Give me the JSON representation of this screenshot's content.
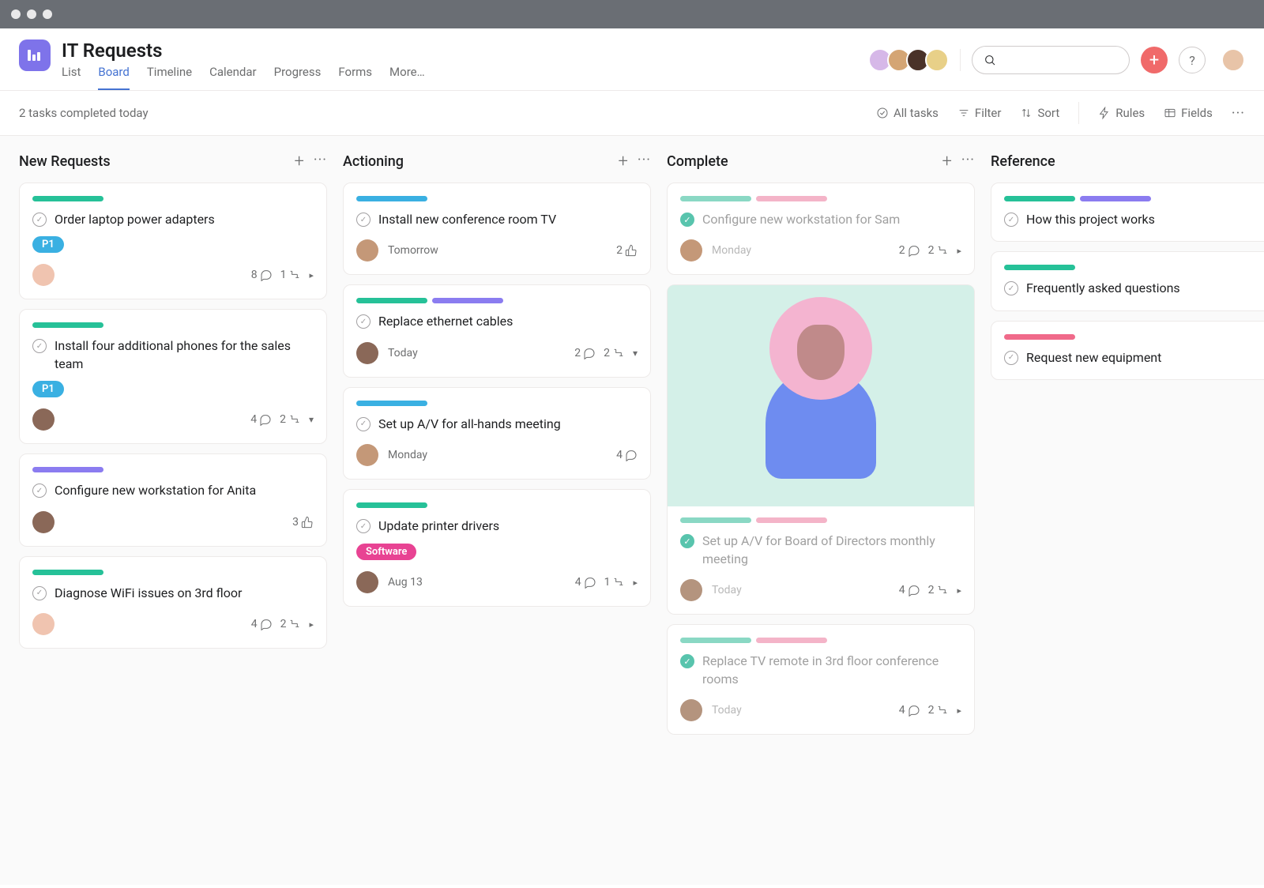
{
  "project": {
    "title": "IT Requests"
  },
  "tabs": [
    "List",
    "Board",
    "Timeline",
    "Calendar",
    "Progress",
    "Forms",
    "More…"
  ],
  "active_tab": "Board",
  "status_text": "2 tasks completed today",
  "toolbar": {
    "all_tasks": "All tasks",
    "filter": "Filter",
    "sort": "Sort",
    "rules": "Rules",
    "fields": "Fields"
  },
  "avatars_header": [
    "#d6b8e8",
    "#d4a574",
    "#4a3228",
    "#e8d088"
  ],
  "user_avatar": "#e8c4a8",
  "columns": [
    {
      "title": "New Requests",
      "cards": [
        {
          "colors": [
            "#26c198"
          ],
          "title": "Order laptop power adapters",
          "tag": "P1",
          "tag_class": "tag-p1",
          "avatar": "#f0c4b0",
          "meta": [
            {
              "n": "8",
              "t": "comment"
            },
            {
              "n": "1",
              "t": "subtask"
            },
            {
              "t": "caret"
            }
          ]
        },
        {
          "colors": [
            "#26c198"
          ],
          "title": "Install four additional phones for the sales team",
          "tag": "P1",
          "tag_class": "tag-p1",
          "avatar": "#8a6858",
          "meta": [
            {
              "n": "4",
              "t": "comment"
            },
            {
              "n": "2",
              "t": "subtask"
            },
            {
              "t": "caret-down"
            }
          ]
        },
        {
          "colors": [
            "#8b7cf0"
          ],
          "title": "Configure new workstation for Anita",
          "avatar": "#8a6858",
          "meta": [
            {
              "n": "3",
              "t": "like"
            }
          ]
        },
        {
          "colors": [
            "#26c198"
          ],
          "title": "Diagnose WiFi issues on 3rd floor",
          "avatar": "#f0c4b0",
          "meta": [
            {
              "n": "4",
              "t": "comment"
            },
            {
              "n": "2",
              "t": "subtask"
            },
            {
              "t": "caret"
            }
          ]
        }
      ]
    },
    {
      "title": "Actioning",
      "cards": [
        {
          "colors": [
            "#3ab0e2"
          ],
          "title": "Install new conference room TV",
          "avatar": "#c49878",
          "date": "Tomorrow",
          "meta": [
            {
              "n": "2",
              "t": "like"
            }
          ]
        },
        {
          "colors": [
            "#26c198",
            "#8b7cf0"
          ],
          "title": "Replace ethernet cables",
          "avatar": "#8a6858",
          "date": "Today",
          "meta": [
            {
              "n": "2",
              "t": "comment"
            },
            {
              "n": "2",
              "t": "subtask"
            },
            {
              "t": "caret-down"
            }
          ]
        },
        {
          "colors": [
            "#3ab0e2"
          ],
          "title": "Set up A/V for all-hands meeting",
          "avatar": "#c49878",
          "date": "Monday",
          "meta": [
            {
              "n": "4",
              "t": "comment"
            }
          ]
        },
        {
          "colors": [
            "#26c198"
          ],
          "title": "Update printer drivers",
          "tag": "Software",
          "tag_class": "tag-software",
          "avatar": "#8a6858",
          "date": "Aug 13",
          "meta": [
            {
              "n": "4",
              "t": "comment"
            },
            {
              "n": "1",
              "t": "subtask"
            },
            {
              "t": "caret"
            }
          ]
        }
      ]
    },
    {
      "title": "Complete",
      "cards": [
        {
          "complete": true,
          "colors": [
            "#8ad8c4",
            "#f4b4c8"
          ],
          "title": "Configure new workstation for Sam",
          "avatar": "#c49878",
          "date": "Monday",
          "meta": [
            {
              "n": "2",
              "t": "comment"
            },
            {
              "n": "2",
              "t": "subtask"
            },
            {
              "t": "caret"
            }
          ]
        },
        {
          "complete": true,
          "illustration": true,
          "colors": [
            "#8ad8c4",
            "#f4b4c8"
          ],
          "title": "Set up A/V for Board of Directors monthly meeting",
          "avatar": "#b4947e",
          "date": "Today",
          "meta": [
            {
              "n": "4",
              "t": "comment"
            },
            {
              "n": "2",
              "t": "subtask"
            },
            {
              "t": "caret"
            }
          ]
        },
        {
          "complete": true,
          "colors": [
            "#8ad8c4",
            "#f4b4c8"
          ],
          "title": "Replace TV remote in 3rd floor conference rooms",
          "avatar": "#b4947e",
          "date": "Today",
          "meta": [
            {
              "n": "4",
              "t": "comment"
            },
            {
              "n": "2",
              "t": "subtask"
            },
            {
              "t": "caret"
            }
          ]
        }
      ]
    },
    {
      "title": "Reference",
      "cards": [
        {
          "colors": [
            "#26c198",
            "#8b7cf0"
          ],
          "title": "How this project works"
        },
        {
          "colors": [
            "#26c198"
          ],
          "title": "Frequently asked questions"
        },
        {
          "colors": [
            "#f06a8a"
          ],
          "title": "Request new equipment"
        }
      ]
    }
  ]
}
